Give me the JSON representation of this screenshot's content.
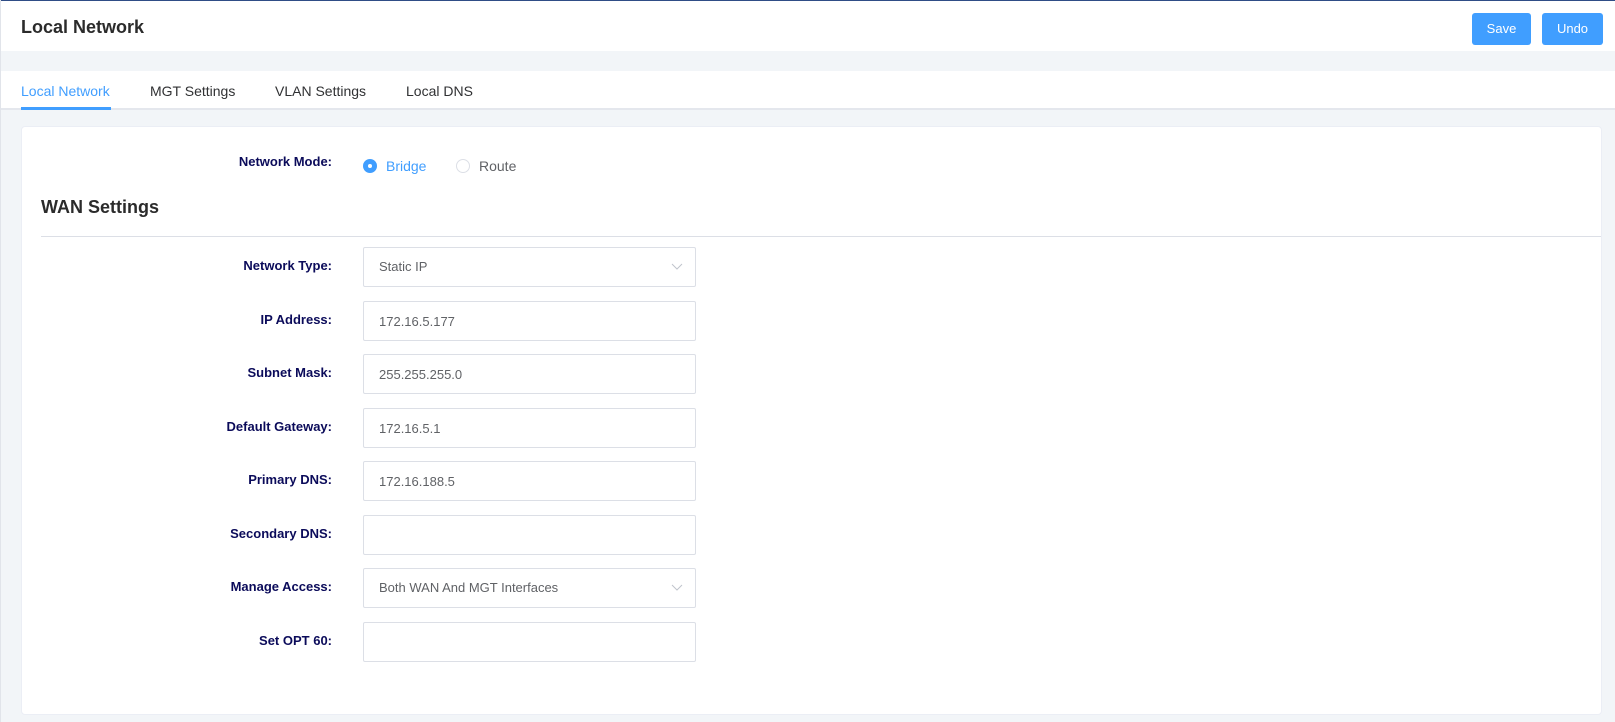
{
  "header": {
    "title": "Local Network",
    "save_label": "Save",
    "undo_label": "Undo"
  },
  "tabs": [
    {
      "label": "Local Network",
      "active": true
    },
    {
      "label": "MGT Settings",
      "active": false
    },
    {
      "label": "VLAN Settings",
      "active": false
    },
    {
      "label": "Local DNS",
      "active": false
    }
  ],
  "form": {
    "network_mode": {
      "label": "Network Mode:",
      "options": [
        {
          "label": "Bridge",
          "checked": true
        },
        {
          "label": "Route",
          "checked": false
        }
      ]
    },
    "wan_section_title": "WAN Settings",
    "network_type": {
      "label": "Network Type:",
      "value": "Static IP",
      "icon": "chevron-down-icon"
    },
    "ip_address": {
      "label": "IP Address:",
      "value": "172.16.5.177"
    },
    "subnet_mask": {
      "label": "Subnet Mask:",
      "value": "255.255.255.0"
    },
    "default_gateway": {
      "label": "Default Gateway:",
      "value": "172.16.5.1"
    },
    "primary_dns": {
      "label": "Primary DNS:",
      "value": "172.16.188.5"
    },
    "secondary_dns": {
      "label": "Secondary DNS:",
      "value": ""
    },
    "manage_access": {
      "label": "Manage Access:",
      "value": "Both WAN And MGT Interfaces",
      "icon": "chevron-down-icon"
    },
    "set_opt_60": {
      "label": "Set OPT 60:",
      "value": ""
    }
  },
  "colors": {
    "accent": "#409eff",
    "label_text": "#0b0b5a",
    "top_border": "#2f4d86"
  }
}
